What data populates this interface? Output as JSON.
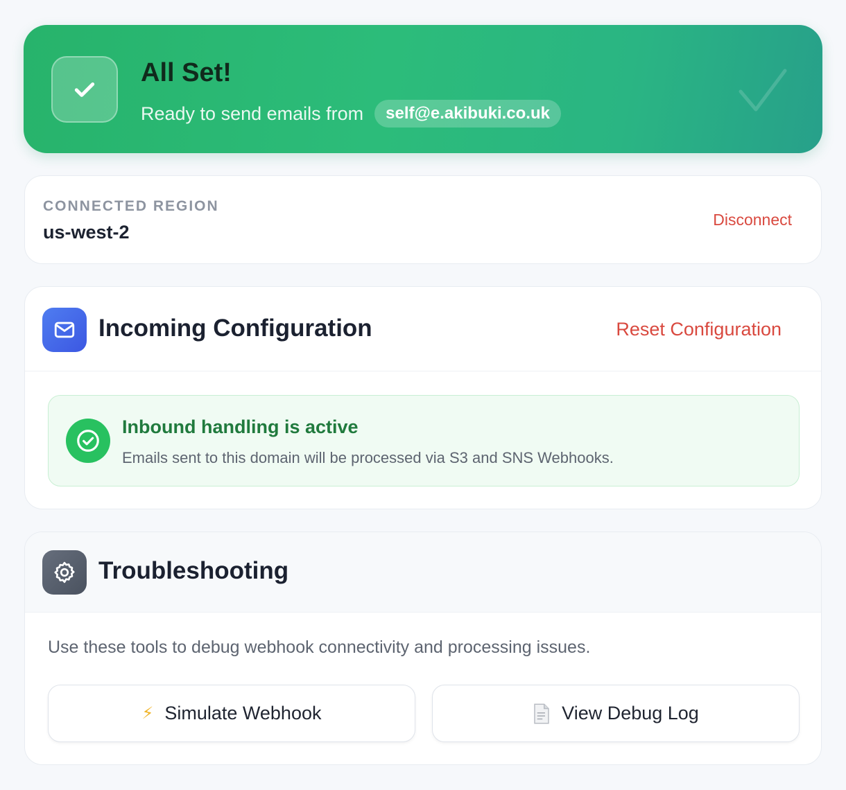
{
  "banner": {
    "title": "All Set!",
    "subtitle": "Ready to send emails from",
    "email": "self@e.akibuki.co.uk",
    "icon": "check-icon"
  },
  "region": {
    "label": "CONNECTED REGION",
    "value": "us-west-2",
    "disconnect_label": "Disconnect"
  },
  "incoming": {
    "title": "Incoming Configuration",
    "icon": "mail-icon",
    "reset_label": "Reset Configuration",
    "status_title": "Inbound handling is active",
    "status_description": "Emails sent to this domain will be processed via S3 and SNS Webhooks.",
    "status_icon": "check-circle-icon"
  },
  "troubleshooting": {
    "title": "Troubleshooting",
    "icon": "gear-icon",
    "description": "Use these tools to debug webhook connectivity and processing issues.",
    "buttons": [
      {
        "label": "Simulate Webhook",
        "icon": "lightning-icon"
      },
      {
        "label": "View Debug Log",
        "icon": "document-icon"
      }
    ]
  },
  "colors": {
    "success_green": "#2cbc7a",
    "danger_red": "#d9493f",
    "accent_blue": "#3c57e2",
    "active_green": "#28c160"
  }
}
